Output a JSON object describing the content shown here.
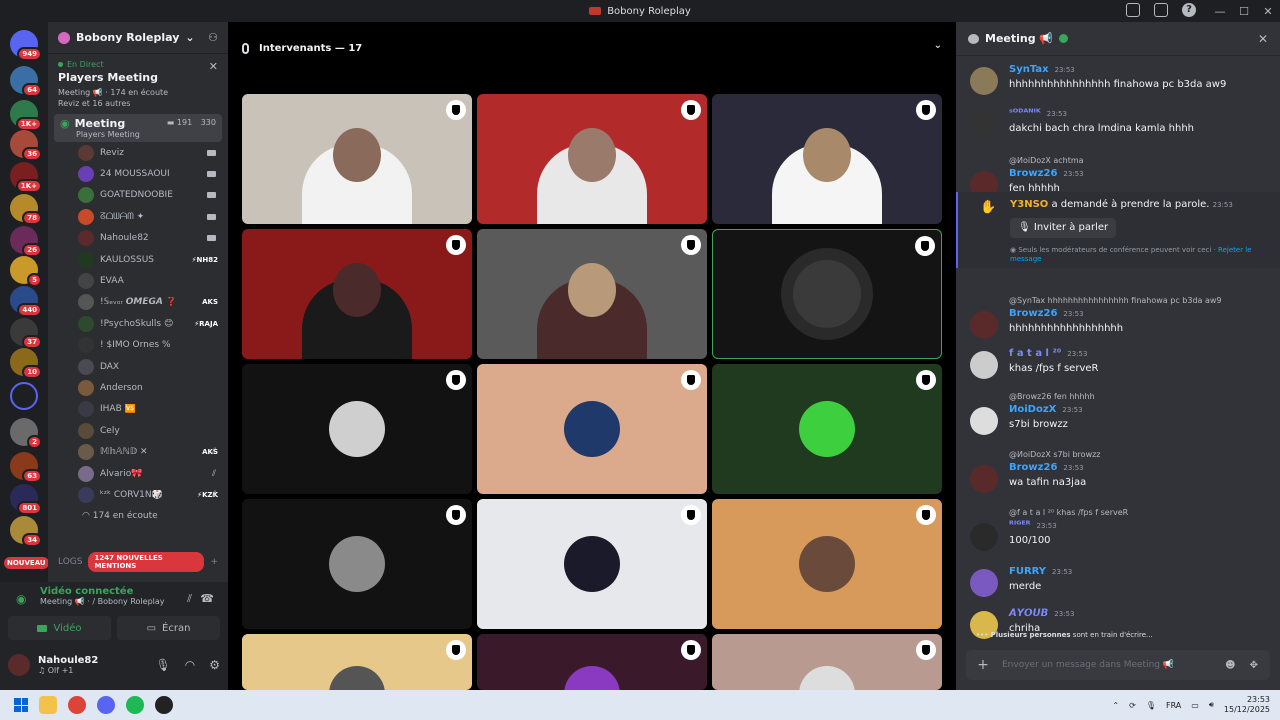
{
  "window": {
    "title": "Bobony Roleplay"
  },
  "rail": {
    "badges": [
      "949",
      "64",
      "1K+",
      "36",
      "1K+",
      "78",
      "26",
      "5",
      "440",
      "37",
      "10",
      "2",
      "63",
      "801",
      "34"
    ],
    "new_label": "NOUVEAU"
  },
  "server": {
    "name": "Bobony Roleplay"
  },
  "live": {
    "status": "En Direct",
    "channel": "Players Meeting",
    "sub1": "Meeting 📢 · 174 en écoute",
    "sub2": "Reviz et 16 autres"
  },
  "meeting": {
    "name": "Meeting",
    "sub": "Players Meeting",
    "count1": "191",
    "count2": "330"
  },
  "voice_users": [
    {
      "name": "Reviz",
      "tag": "",
      "color": "#5b3a33",
      "cam": true
    },
    {
      "name": "24 MOUSSAOUI",
      "tag": "",
      "color": "#6a3fb3",
      "cam": true
    },
    {
      "name": "GOATEDNOOBIE",
      "tag": "",
      "color": "#3a6e3a",
      "cam": true
    },
    {
      "name": "ᘔᗝᗯᗩᗰ ✦",
      "tag": "",
      "color": "#c94a2a",
      "cam": true
    },
    {
      "name": "Nahoule82",
      "tag": "",
      "color": "#5b2b2b",
      "cam": true
    },
    {
      "name": "KAULOSSUS",
      "tag": "⚡NH82",
      "color": "#1f3a1f",
      "cam": false
    },
    {
      "name": "EVAA",
      "tag": "",
      "color": "#444",
      "cam": false
    },
    {
      "name": "!𝕊ₑᵥₒᵣ 𝙊𝙈𝙀𝙂𝘼 ❓",
      "tag": "AKS",
      "color": "#555",
      "cam": false
    },
    {
      "name": "!PsychoSkulls 😊",
      "tag": "⚡RAJA",
      "color": "#2d4a2d",
      "cam": false
    },
    {
      "name": "! $IMO Ornes %",
      "tag": "",
      "color": "#333",
      "cam": false
    },
    {
      "name": "DAX",
      "tag": "",
      "color": "#4a4a52",
      "cam": false
    },
    {
      "name": "Anderson",
      "tag": "",
      "color": "#7a5a3a",
      "cam": false
    },
    {
      "name": "IHAB 🆚",
      "tag": "",
      "color": "#3a3a44",
      "cam": false
    },
    {
      "name": "Cely",
      "tag": "",
      "color": "#5a4a3a",
      "cam": false
    },
    {
      "name": "𝕄𝕙𝔸ℕ𝔻 ✕",
      "tag": "AKS",
      "color": "#6a5a4a",
      "cam": false,
      "muted": true
    },
    {
      "name": "Alvario🎀",
      "tag": "",
      "color": "#7a6a8a",
      "cam": false,
      "muted": true
    },
    {
      "name": "ᵏᶻᵏ CORV1N🎲",
      "tag": "⚡KZK",
      "color": "#3a3a5a",
      "cam": false,
      "muted": true
    }
  ],
  "listen_count": "174 en écoute",
  "logs": {
    "label": "LOGS",
    "mentions": "1247 NOUVELLES MENTIONS"
  },
  "voice_panel": {
    "connected": "Vidéo connectée",
    "where": "Meeting 📢 · / Bobony Roleplay",
    "video": "Vidéo",
    "screen": "Écran"
  },
  "user": {
    "name": "Nahoule82",
    "status": "♫ Olf +1"
  },
  "stage": {
    "header": "Intervenants — 17"
  },
  "chat": {
    "title": "Meeting 📢",
    "messages": [
      {
        "user": "SynTax",
        "color": "#3ba5ff",
        "time": "23:53",
        "text": "hhhhhhhhhhhhhhhh finahowa pc b3da aw9",
        "reply": ""
      },
      {
        "user": "ˢᴼᴰᴬᴺᴵᴷ",
        "color": "#7b8af8",
        "time": "23:53",
        "text": "dakchi bach chra lmdina kamla hhhh",
        "reply": ""
      },
      {
        "user": "Browz26",
        "color": "#3ba5ff",
        "time": "23:53",
        "text": "fen hhhhh",
        "reply": "@ИoiDozX achtma"
      },
      {
        "user": "Browz26",
        "color": "#3ba5ff",
        "time": "23:53",
        "text": "hhhhhhhhhhhhhhhhhh",
        "reply": "@SynTax hhhhhhhhhhhhhhhh finahowa pc b3da aw9"
      },
      {
        "user": "f a t a l ²⁰",
        "color": "#7b8af8",
        "time": "23:53",
        "text": "khas /fps f serveR",
        "reply": ""
      },
      {
        "user": "ИoiDozX",
        "color": "#3ba5ff",
        "time": "23:53",
        "text": "s7bi browzz",
        "reply": "@Browz26 fen hhhhh"
      },
      {
        "user": "Browz26",
        "color": "#3ba5ff",
        "time": "23:53",
        "text": "wa tafin na3jaa",
        "reply": "@ИoiDozX s7bi browzz"
      },
      {
        "user": "ᴿᴵᴳᴱᴿ",
        "color": "#7b8af8",
        "time": "23:53",
        "text": "100/100",
        "reply": "@f a t a l ²⁰ khas /fps f serveR"
      },
      {
        "user": "FURRY",
        "color": "#3ba5ff",
        "time": "23:53",
        "text": "merde",
        "reply": ""
      },
      {
        "user": "𝘼𝙔𝙊𝙐𝘽",
        "color": "#7b8af8",
        "time": "23:53",
        "text": "chriha",
        "reply": ""
      }
    ],
    "speak_request": {
      "user": "Y3NSO",
      "text": "a demandé à prendre la parole.",
      "time": "23:53",
      "button": "Inviter à parler",
      "note": "Seuls les modérateurs de conférence peuvent voir ceci ·",
      "reject": "Rejeter le message"
    },
    "typing": {
      "who": "Plusieurs personnes",
      "rest": "sont en train d'écrire..."
    },
    "input_placeholder": "Envoyer un message dans Meeting 📢"
  },
  "taskbar": {
    "lang": "FRA",
    "time": "23:53",
    "date": "15/12/2025"
  }
}
